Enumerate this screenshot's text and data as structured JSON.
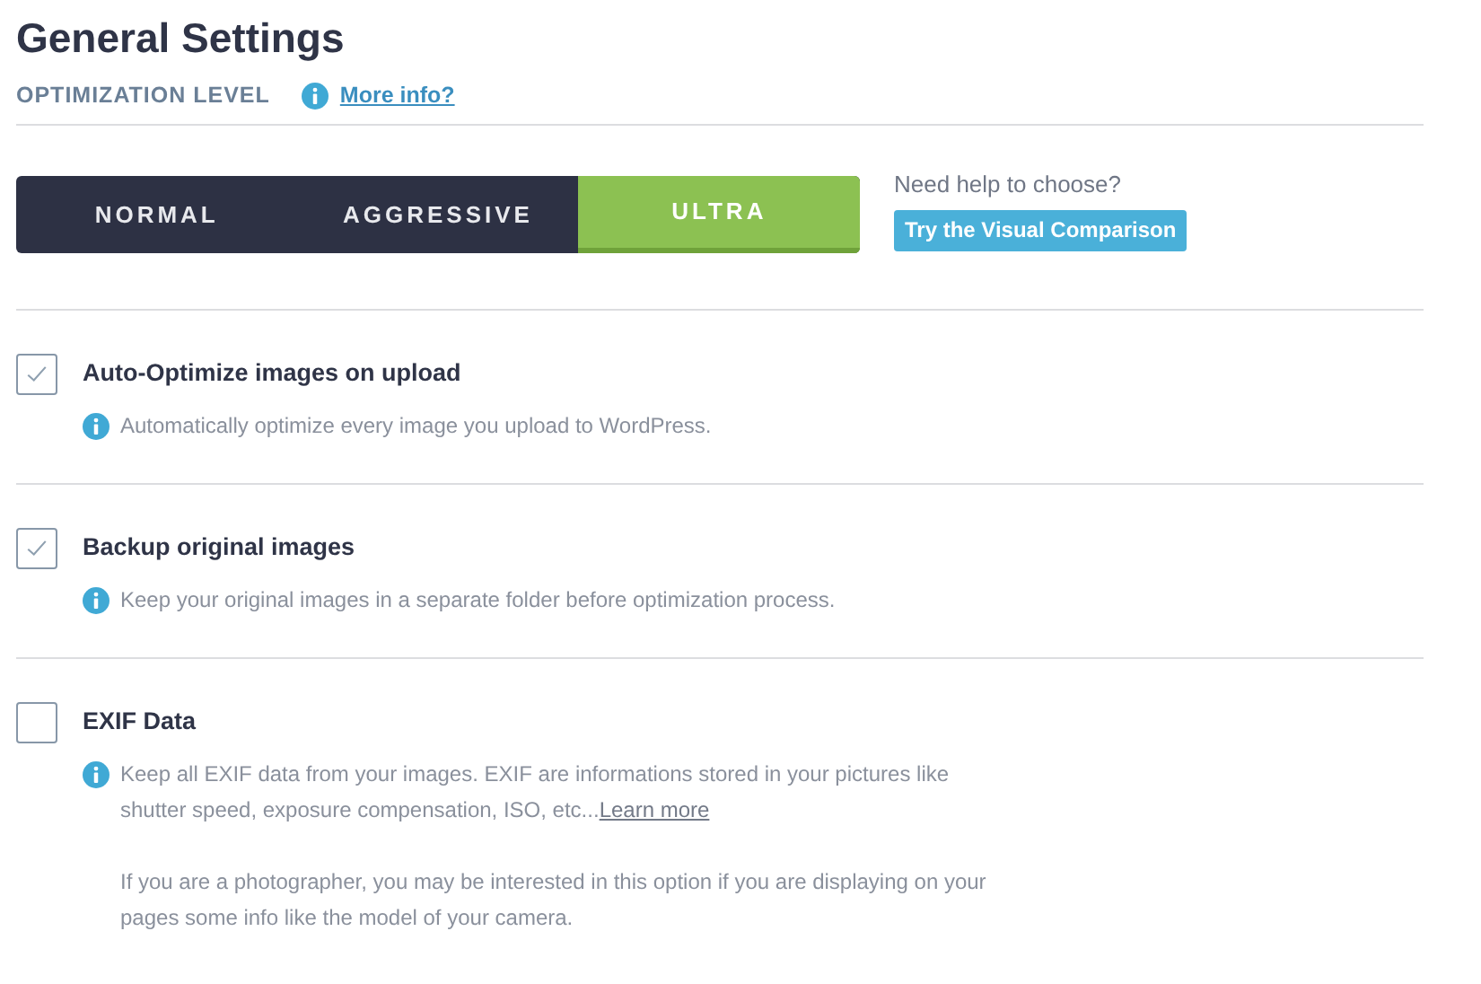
{
  "title": "General Settings",
  "optimization": {
    "label": "OPTIMIZATION LEVEL",
    "more_info": "More info?",
    "levels": [
      {
        "label": "NORMAL",
        "selected": false
      },
      {
        "label": "AGGRESSIVE",
        "selected": false
      },
      {
        "label": "ULTRA",
        "selected": true
      }
    ],
    "help": "Need help to choose?",
    "help_button": "Try the Visual Comparison"
  },
  "options": [
    {
      "label": "Auto-Optimize images on upload",
      "checked": true,
      "description": "Automatically optimize every image you upload to WordPress."
    },
    {
      "label": "Backup original images",
      "checked": true,
      "description": "Keep your original images in a separate folder before optimization process."
    },
    {
      "label": "EXIF Data",
      "checked": false,
      "description": "Keep all EXIF data from your images. EXIF are informations stored in your pictures like shutter speed, exposure compensation, ISO, etc...",
      "link": "Learn more",
      "note": "If you are a photographer, you may be interested in this option if you are displaying on your pages some info like the model of your camera."
    }
  ]
}
